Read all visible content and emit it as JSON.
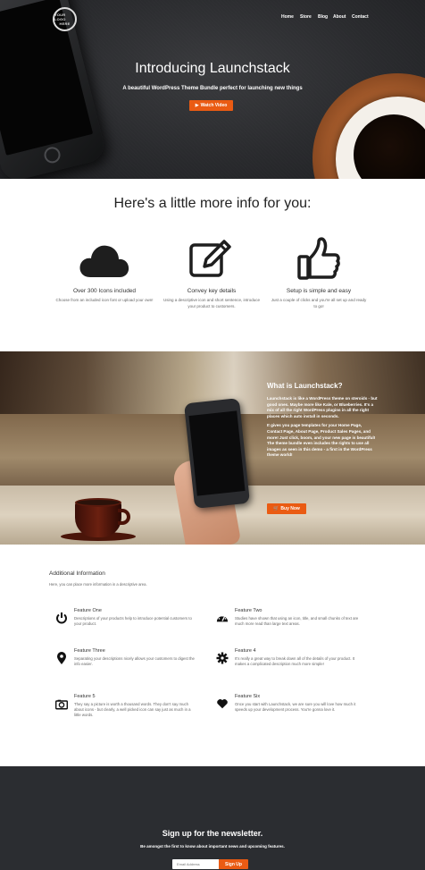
{
  "nav": {
    "logo_line1": "YOUR LOGO",
    "logo_line2": "HERE",
    "items": [
      "Home",
      "Store",
      "Blog",
      "About",
      "Contact"
    ]
  },
  "hero": {
    "title": "Introducing Launchstack",
    "subtitle": "A beautiful WordPress Theme Bundle perfect for launching new things",
    "button": "Watch Video"
  },
  "info": {
    "title": "Here's a little more info for you:",
    "columns": [
      {
        "icon": "cloud-icon",
        "heading": "Over 300 Icons included",
        "text": "Choose from an included icon font or upload your own!"
      },
      {
        "icon": "edit-icon",
        "heading": "Convey key details",
        "text": "Using a descriptive icon and short sentence, introduce your product to customers."
      },
      {
        "icon": "thumbs-up-icon",
        "heading": "Setup is simple and easy",
        "text": "Just a couple of clicks and you're all set up and ready to go!"
      }
    ]
  },
  "what_is": {
    "title": "What is Launchstack?",
    "para1": "Launchstack is like a WordPress theme on steroids - but good ones. Maybe more like Kale, or Blueberries. It's a mix of all the right WordPress plugins in all the right places which auto install in seconds.",
    "para2": "It gives you page templates for your Home Page, Contact Page, About Page, Product Sales Pages, and more! Just click, boom, and your new page is beautiful! The theme bundle even includes the rights to use all images as seen in this demo - a first in the WordPress theme world!",
    "button": "Buy Now"
  },
  "additional": {
    "title": "Additional Information",
    "subtitle": "Here, you can place more information in a descriptive area.",
    "features": [
      {
        "icon": "power-icon",
        "title": "Feature One",
        "text": "Descriptions of your products help to introduce potential customers to your product."
      },
      {
        "icon": "dashboard-icon",
        "title": "Feature Two",
        "text": "Studies have shown that using an icon, title, and small chunks of text are much more read than large text areas."
      },
      {
        "icon": "map-pin-icon",
        "title": "Feature Three",
        "text": "Separating your descriptions nicely allows your customers to digest the info easier."
      },
      {
        "icon": "gear-icon",
        "title": "Feature 4",
        "text": "It's really a great way to break down all of the details of your product. It makes a complicated description much more simple!"
      },
      {
        "icon": "camera-icon",
        "title": "Feature 5",
        "text": "They say a picture is worth a thousand words. They don't say much about icons - but clearly, a well picked icon can say just as much in a little words."
      },
      {
        "icon": "heart-icon",
        "title": "Feature Six",
        "text": "Once you start with Launchstack, we are sure you will love how much it speeds up your development process. You're gonna love it."
      }
    ]
  },
  "newsletter": {
    "title": "Sign up for the newsletter.",
    "subtitle": "Be amongst the first to know about important news and upcoming features.",
    "placeholder": "Email Address",
    "button": "Sign Up"
  },
  "colors": {
    "accent": "#ea5b13",
    "dark": "#2b2d31"
  }
}
